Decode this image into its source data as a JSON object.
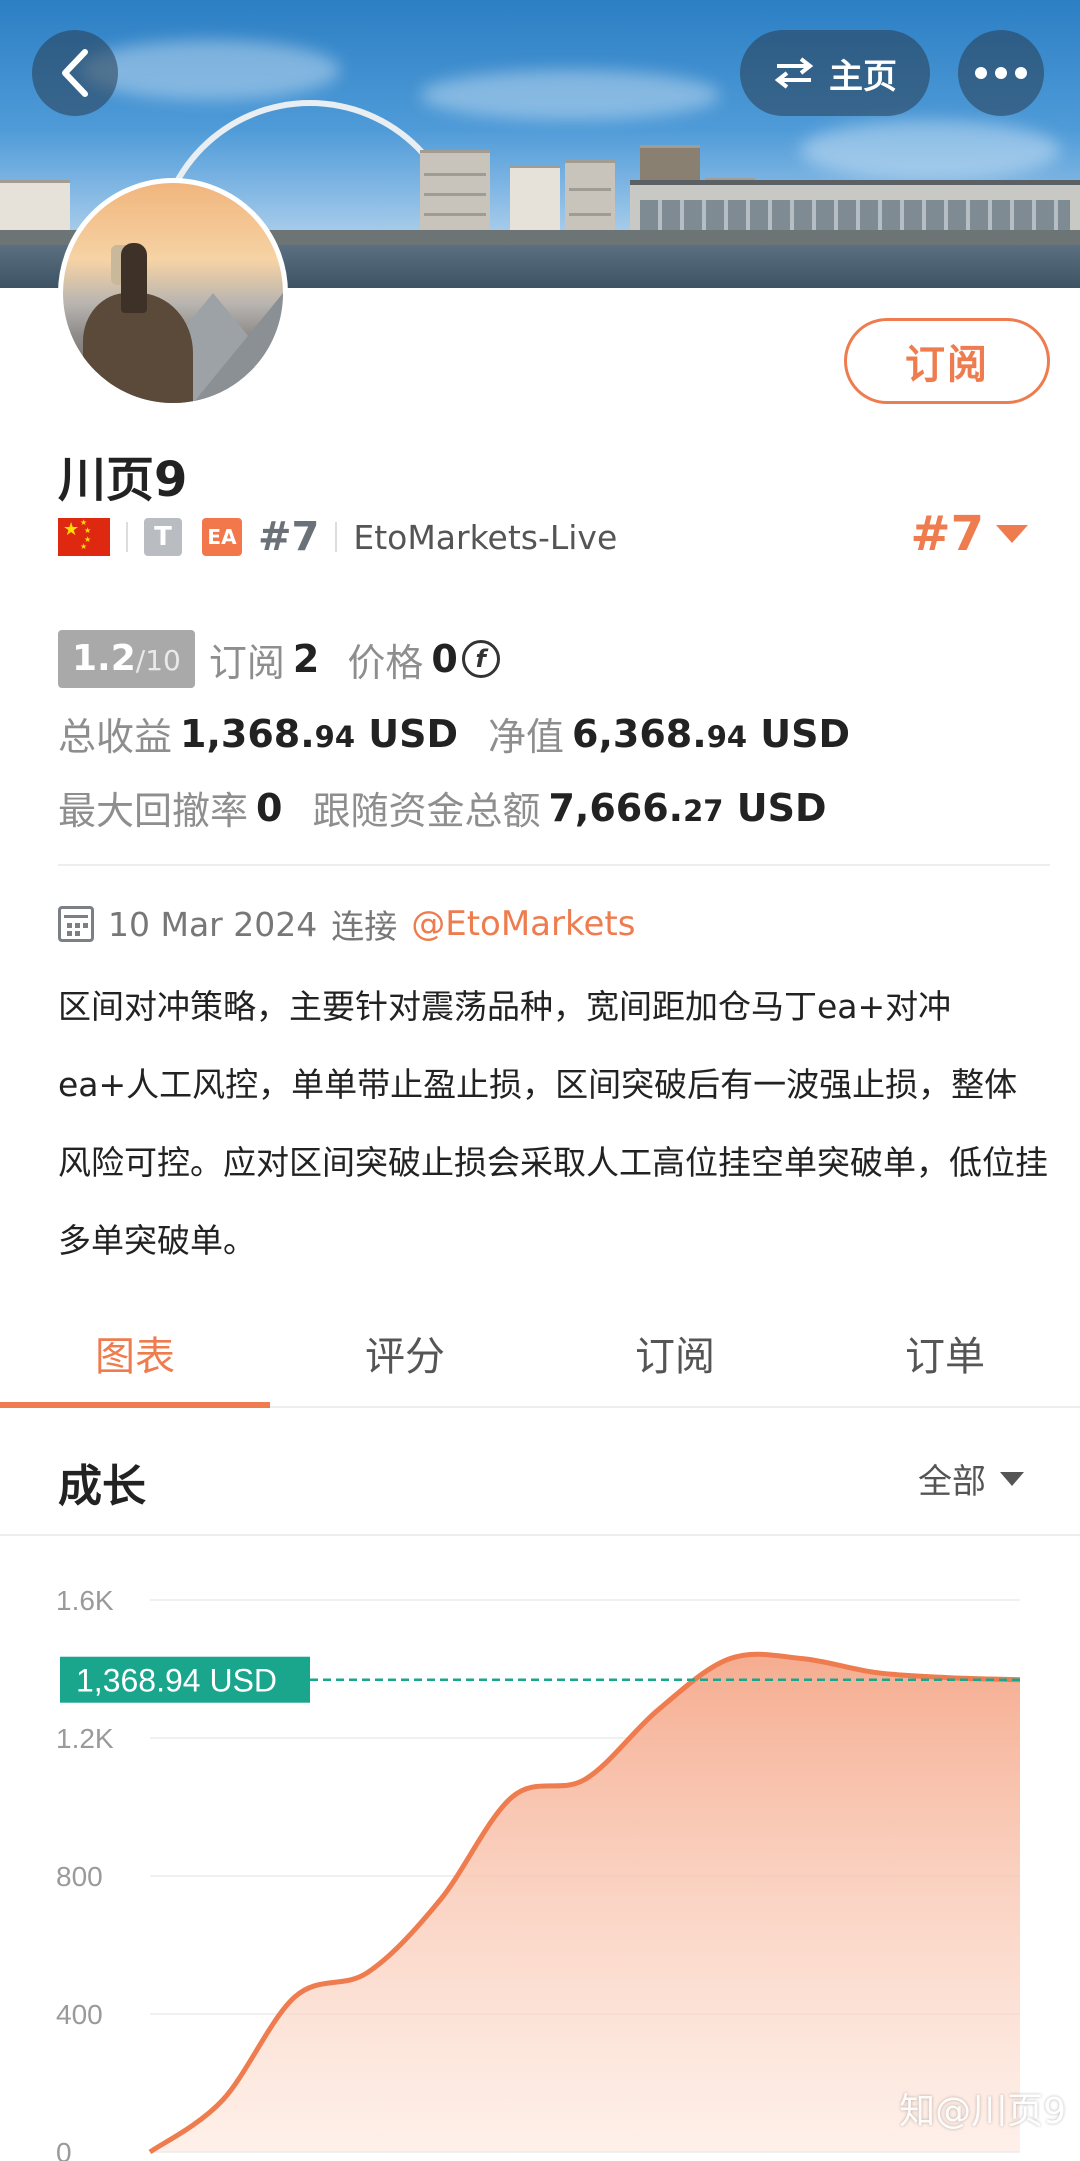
{
  "header": {
    "home_label": "主页"
  },
  "profile": {
    "name": "川页9",
    "subscribe_label": "订阅",
    "badge_t": "T",
    "badge_ea": "EA",
    "rank_small": "#7",
    "broker": "EtoMarkets-Live",
    "rank_big": "#7"
  },
  "stats": {
    "score": "1.2",
    "score_max": "/10",
    "subscribe_label": "订阅",
    "subscribe_count": "2",
    "price_label": "价格",
    "price_value": "0",
    "coin_symbol": "f",
    "total_profit_label": "总收益",
    "total_profit_int": "1,368.",
    "total_profit_dec": "94",
    "total_profit_unit": "USD",
    "net_value_label": "净值",
    "net_value_int": "6,368.",
    "net_value_dec": "94",
    "net_value_unit": "USD",
    "max_drawdown_label": "最大回撤率",
    "max_drawdown_value": "0",
    "follow_total_label": "跟随资金总额",
    "follow_total_int": "7,666.",
    "follow_total_dec": "27",
    "follow_total_unit": "USD"
  },
  "info": {
    "date": "10 Mar 2024",
    "connect_label": "连接",
    "connect_link": "@EtoMarkets",
    "description": "区间对冲策略，主要针对震荡品种，宽间距加仓马丁ea+对冲ea+人工风控，单单带止盈止损，区间突破后有一波强止损，整体风险可控。应对区间突破止损会采取人工高位挂空单突破单，低位挂多单突破单。"
  },
  "tabs": [
    {
      "label": "图表",
      "active": true
    },
    {
      "label": "评分",
      "active": false
    },
    {
      "label": "订阅",
      "active": false
    },
    {
      "label": "订单",
      "active": false
    }
  ],
  "growth": {
    "title": "成长",
    "range_label": "全部"
  },
  "chart_data": {
    "type": "area",
    "y_ticks": [
      "0",
      "400",
      "800",
      "1.2K",
      "1.6K"
    ],
    "ylim": [
      0,
      1600
    ],
    "x": [
      0,
      1,
      2,
      3,
      4,
      5,
      6,
      7,
      8,
      9,
      10,
      11,
      12
    ],
    "values": [
      0,
      150,
      450,
      520,
      730,
      1030,
      1080,
      1280,
      1430,
      1430,
      1390,
      1375,
      1369
    ],
    "current_label": "1,368.94 USD",
    "current_value": 1368.94,
    "colors": {
      "line": "#ee7c4e",
      "fill": "#f7b89f",
      "marker": "#1aa68d"
    }
  },
  "watermark": "知@川页9"
}
